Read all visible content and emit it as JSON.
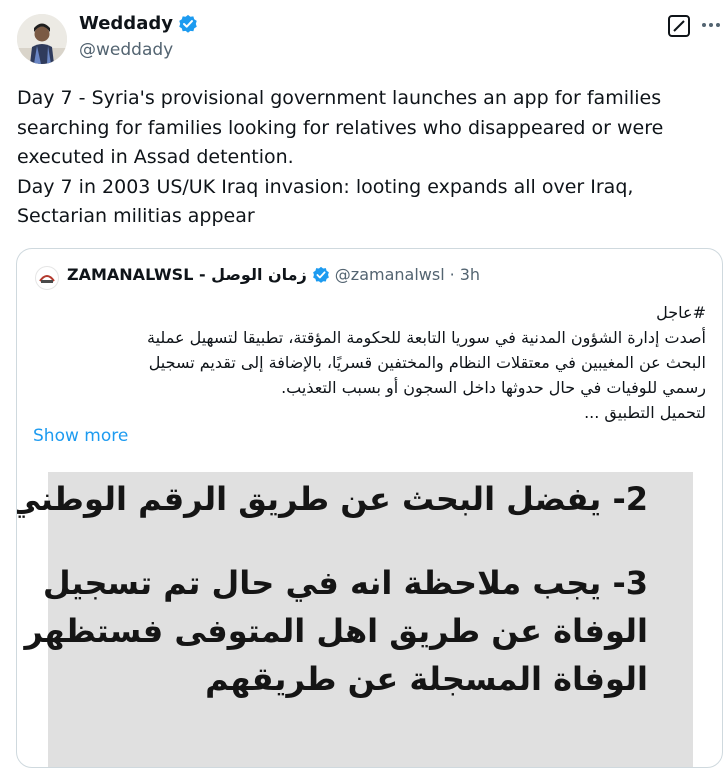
{
  "author": {
    "name": "Weddady",
    "handle": "@weddady",
    "verified_color": "#1d9bf0"
  },
  "header_icons": [
    "grok-icon",
    "more-horizontal-icon"
  ],
  "tweet": {
    "text": "Day 7 - Syria's provisional government launches an app for families\nsearching for families looking for relatives who disappeared or were\nexecuted in Assad detention.\nDay 7 in 2003 US/UK Iraq invasion: looting expands all over Iraq,\nSectarian militias appear"
  },
  "quote": {
    "name": "ZAMANALWSL - زمان الوصل",
    "handle": "@zamanalwsl",
    "separator": "·",
    "time": "3h",
    "text": "#عاجل\nأصدت إدارة الشؤون المدنية في سوريا التابعة للحكومة المؤقتة، تطبيقا لتسهيل عملية\nالبحث عن المغيبين في معتقلات النظام والمختفين قسريًا، بالإضافة إلى تقديم تسجيل\nرسمي للوفيات في حال حدوثها داخل السجون أو بسبب التعذيب.\nلتحميل التطبيق ...",
    "show_more": "Show more",
    "image_lines": [
      "2- يفضل البحث عن طريق الرقم الوطني",
      "3- يجب ملاحظة انه في حال تم تسجيل",
      "الوفاة عن طريق اهل المتوفى فستظهر",
      "الوفاة المسجلة عن طريقهم"
    ]
  }
}
